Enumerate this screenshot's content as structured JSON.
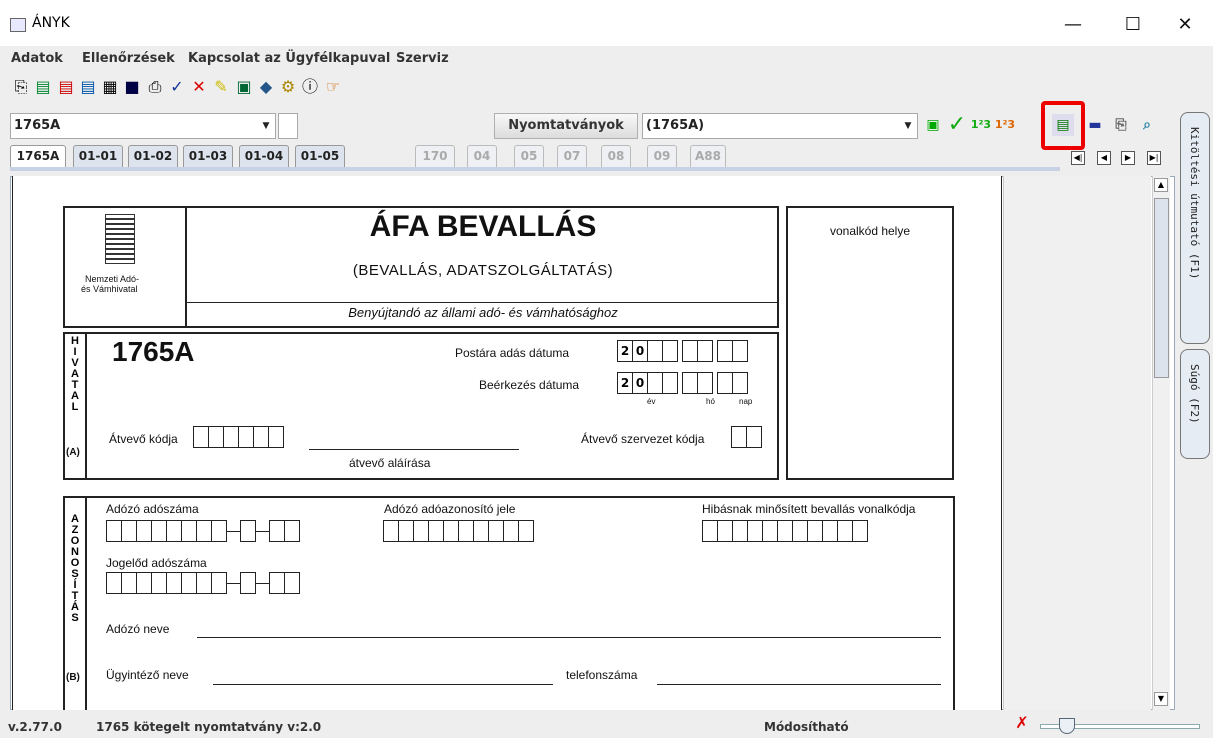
{
  "window": {
    "title": "ÁNYK",
    "minimize": "—",
    "maximize": "☐",
    "close": "✕"
  },
  "menu": [
    "Adatok",
    "Ellenőrzések",
    "Kapcsolat az Ügyfélkapuval",
    "Szerviz"
  ],
  "toolbar_icons": [
    "copy-icon",
    "open-icon",
    "open-red-icon",
    "save-icon",
    "print-preview-icon",
    "book-icon",
    "print-icon",
    "check-icon",
    "delete-icon",
    "edit-icon",
    "calc-icon",
    "book2-icon",
    "gears-icon",
    "info-icon",
    "pointer-icon"
  ],
  "form_selector": {
    "value": "1765A"
  },
  "nyomtatvanyok": {
    "label": "Nyomtatványok",
    "value": "(1765A)"
  },
  "tabs": [
    {
      "label": "1765A",
      "enabled": true
    },
    {
      "label": "01-01",
      "enabled": true
    },
    {
      "label": "01-02",
      "enabled": true
    },
    {
      "label": "01-03",
      "enabled": true
    },
    {
      "label": "01-04",
      "enabled": true
    },
    {
      "label": "01-05",
      "enabled": true
    },
    {
      "label": "170",
      "enabled": false
    },
    {
      "label": "04",
      "enabled": false
    },
    {
      "label": "05",
      "enabled": false
    },
    {
      "label": "07",
      "enabled": false
    },
    {
      "label": "08",
      "enabled": false
    },
    {
      "label": "09",
      "enabled": false
    },
    {
      "label": "A88",
      "enabled": false
    }
  ],
  "side": {
    "help": "Kitöltési útmutató (F1)",
    "sugo": "Súgó (F2)"
  },
  "form": {
    "title": "ÁFA BEVALLÁS",
    "subtitle": "(BEVALLÁS, ADATSZOLGÁLTATÁS)",
    "submit_to": "Benyújtandó az állami adó- és vámhatósághoz",
    "agency_line1": "Nemzeti Adó-",
    "agency_line2": "és Vámhivatal",
    "barcode_place": "vonalkód helye",
    "form_code": "1765A",
    "post_date": "Postára adás dátuma",
    "arrival_date": "Beérkezés dátuma",
    "year_prefix": [
      "2",
      "0"
    ],
    "ev": "év",
    "ho": "hó",
    "nap": "nap",
    "receiver_code": "Átvevő kódja",
    "receiver_org_code": "Átvevő szervezet kódja",
    "receiver_signature": "átvevő aláírása",
    "hivatal_section_letters": "HIVATAL",
    "hivatal_section": "(A)",
    "tax_number": "Adózó adószáma",
    "tax_id": "Adózó adóazonosító jele",
    "invalid_barcode": "Hibásnak minősített bevallás vonalkódja",
    "predecessor_tax_number": "Jogelőd adószáma",
    "taxpayer_name": "Adózó neve",
    "clerk_name": "Ügyintéző neve",
    "phone": "telefonszáma",
    "azonositas_letters": "AZONOSÍTÁS",
    "azonositas_section": "(B)"
  },
  "status": {
    "version": "v.2.77.0",
    "form_info": "1765 kötegelt nyomtatvány v:2.0",
    "mode": "Módosítható"
  }
}
